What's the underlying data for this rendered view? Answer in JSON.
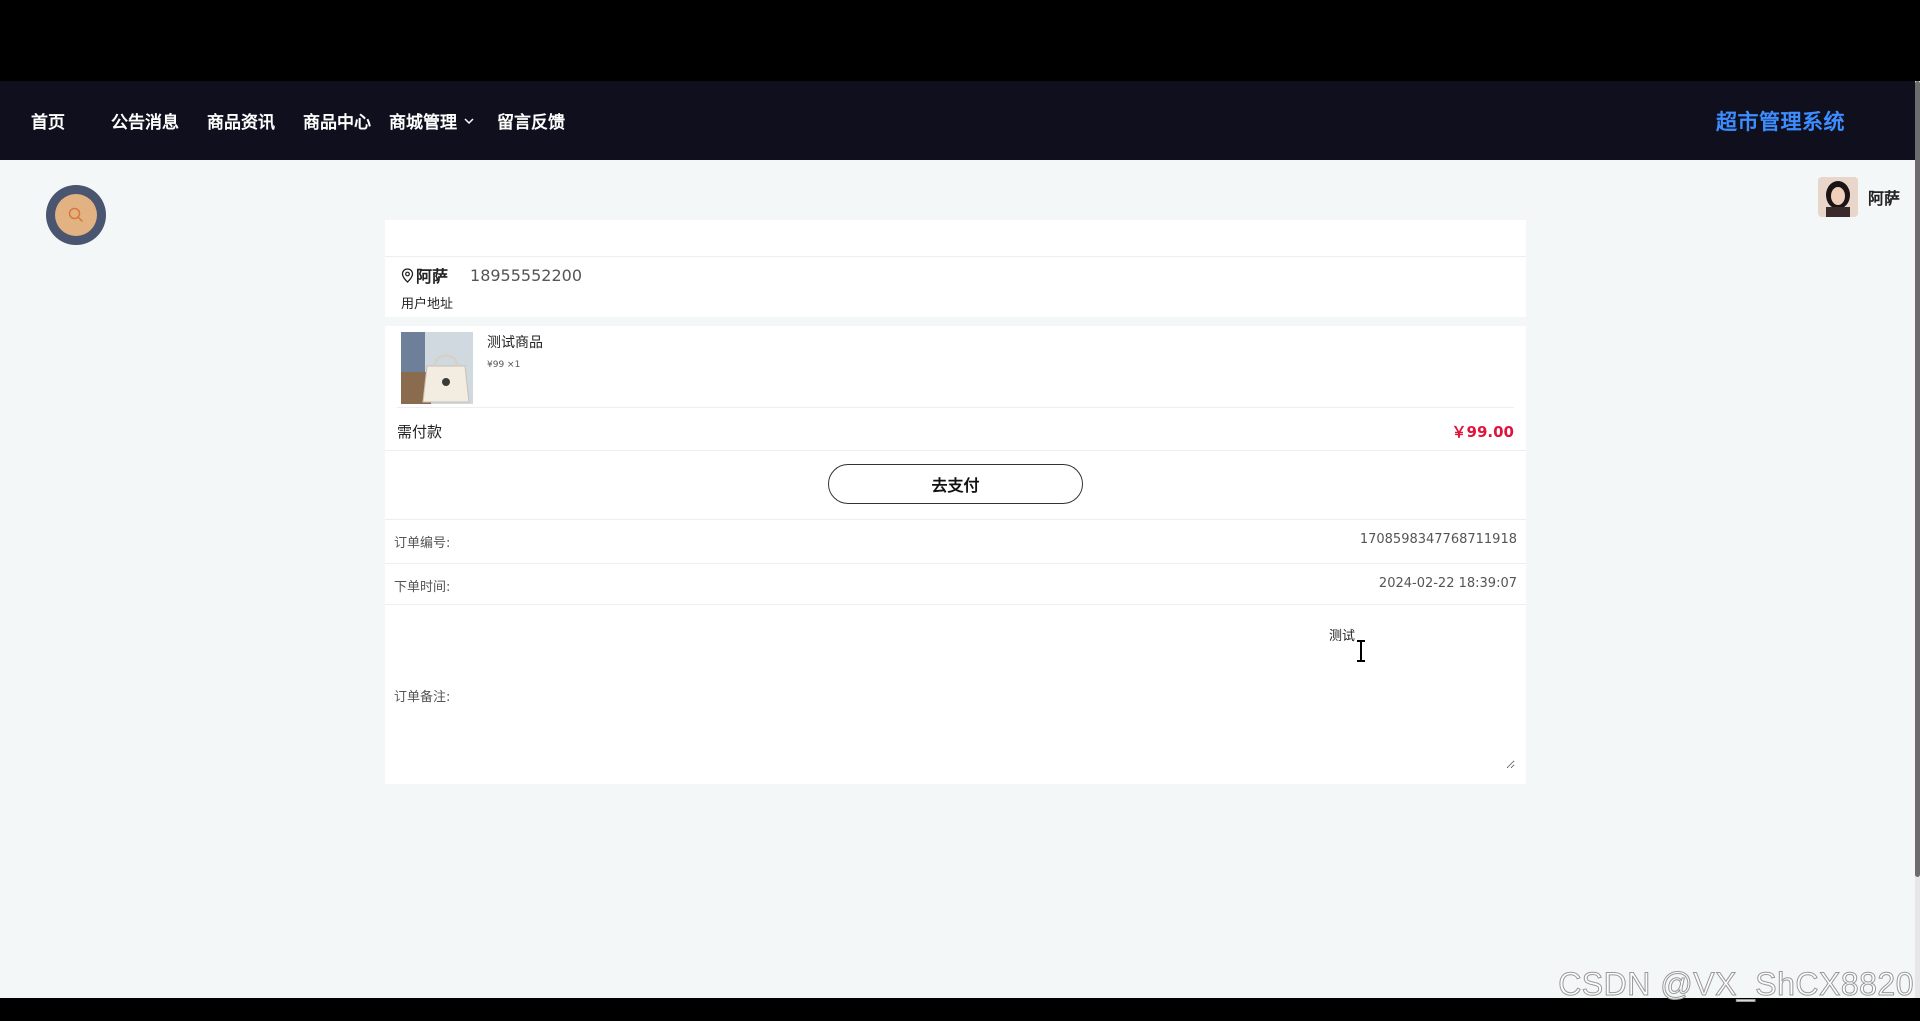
{
  "nav": {
    "items": [
      {
        "label": "首页"
      },
      {
        "label": "公告消息"
      },
      {
        "label": "商品资讯"
      },
      {
        "label": "商品中心"
      },
      {
        "label": "商城管理"
      },
      {
        "label": "留言反馈"
      }
    ],
    "brand": "超市管理系统"
  },
  "user": {
    "name": "阿萨"
  },
  "address": {
    "name": "阿萨",
    "phone": "18955552200",
    "detail": "用户地址"
  },
  "goods": {
    "name": "测试商品",
    "price_qty": "¥99 ×1"
  },
  "payment": {
    "label": "需付款",
    "amount": "￥99.00",
    "button_label": "去支付"
  },
  "order": {
    "number_label": "订单编号:",
    "number_value": "1708598347768711918",
    "time_label": "下单时间:",
    "time_value": "2024-02-22 18:39:07",
    "remark_label": "订单备注:",
    "remark_value": "测试"
  },
  "watermark": "CSDN @VX_ShCX8820",
  "colors": {
    "nav_bg": "#0f0f1e",
    "brand": "#3d8dff",
    "price": "#e0143c",
    "page_bg": "#f4f7f8"
  }
}
